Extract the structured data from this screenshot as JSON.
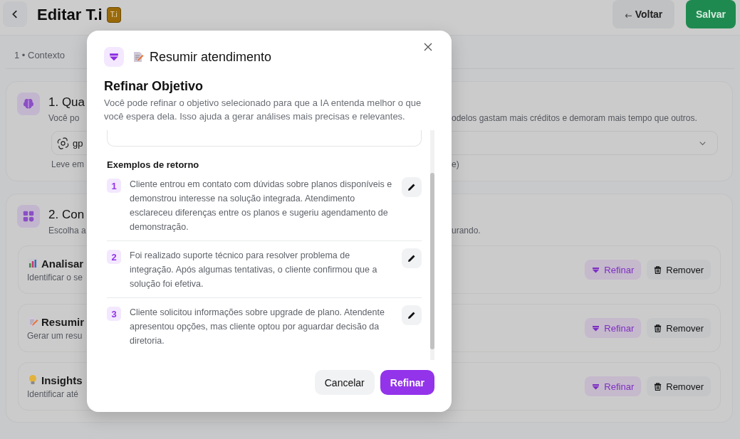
{
  "header": {
    "title": "Editar T.i",
    "badge": "T.i",
    "buttons": [
      {
        "label": "Voltar",
        "kind": "secondary"
      },
      {
        "label": "Salvar",
        "kind": "primary"
      }
    ]
  },
  "steps": [
    {
      "label": "1 • Contexto"
    }
  ],
  "sections": [
    {
      "kind": "model",
      "title": "1. Qua",
      "description": "Você po",
      "description_right": "odelos gastam mais créditos e demoram mais tempo que outros.",
      "select": {
        "value": "gp"
      },
      "hint": "Leve em",
      "hint_right": "e)"
    },
    {
      "kind": "objectives",
      "title": "2. Con",
      "description": "Escolha a",
      "description_right": "urando.",
      "objectives": [
        {
          "kind": "chart",
          "title": "Analisar",
          "description": "Identificar o se",
          "actions": [
            "Refinar",
            "Remover"
          ]
        },
        {
          "kind": "memo",
          "title": "Resumir",
          "description": "Gerar um resu",
          "actions": [
            "Refinar",
            "Remover"
          ]
        },
        {
          "kind": "bulb",
          "title": "Insights",
          "description": "Identificar até",
          "actions": [
            "Refinar",
            "Remover"
          ]
        }
      ]
    }
  ],
  "modal": {
    "title": "Resumir atendimento",
    "heading": "Refinar Objetivo",
    "description": "Você pode refinar o objetivo selecionado para que a IA entenda melhor o que você espera dela. Isso ajuda a gerar análises mais precisas e relevantes.",
    "examples_title": "Exemplos de retorno",
    "examples": [
      {
        "number": "1",
        "text": "Cliente entrou em contato com dúvidas sobre planos disponíveis e demonstrou interesse na solução integrada. Atendimento esclareceu diferenças entre os planos e sugeriu agendamento de demonstração."
      },
      {
        "number": "2",
        "text": "Foi realizado suporte técnico para resolver problema de integração. Após algumas tentativas, o cliente confirmou que a solução foi efetiva."
      },
      {
        "number": "3",
        "text": "Cliente solicitou informações sobre upgrade de plano. Atendente apresentou opções, mas cliente optou por aguardar decisão da diretoria."
      }
    ],
    "buttons": [
      {
        "label": "Cancelar",
        "kind": "secondary"
      },
      {
        "label": "Refinar",
        "kind": "primary"
      }
    ]
  }
}
